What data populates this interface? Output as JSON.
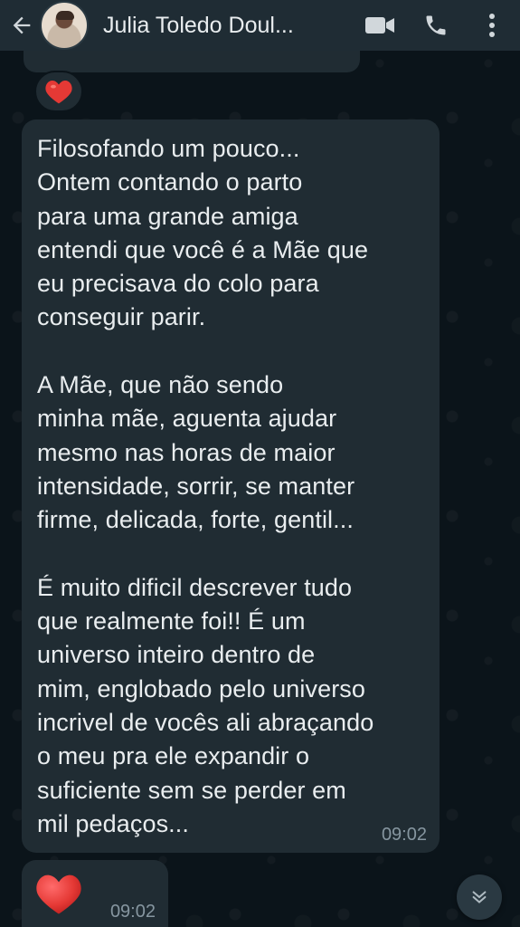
{
  "header": {
    "contact_name": "Julia Toledo Doul...",
    "back_icon": "arrow-left-icon",
    "video_icon": "video-camera-icon",
    "call_icon": "phone-icon",
    "menu_icon": "kebab-menu-icon"
  },
  "reaction": {
    "emoji": "❤️"
  },
  "messages": [
    {
      "text": "Filosofando um pouco...\nOntem contando o parto\npara uma grande amiga\nentendi que você é a Mãe que\neu precisava do colo para\nconseguir parir.\n\nA Mãe, que não sendo\nminha mãe, aguenta ajudar\nmesmo nas horas de maior\nintensidade, sorrir, se manter\nfirme, delicada, forte, gentil...\n\nÉ muito dificil descrever tudo\nque realmente foi!! É um\nuniverso inteiro dentro de\nmim, englobado pelo universo\nincrivel de vocês ali abraçando\no meu pra ele expandir o\nsuficiente sem se perder em\nmil pedaços...",
      "time": "09:02"
    },
    {
      "emoji": "heart-emoji",
      "time": "09:02"
    }
  ],
  "colors": {
    "background": "#0b141a",
    "header": "#1f2c34",
    "bubble": "#202c33",
    "text": "#e9edef",
    "meta": "#8696a0",
    "heart": "#e53935"
  }
}
